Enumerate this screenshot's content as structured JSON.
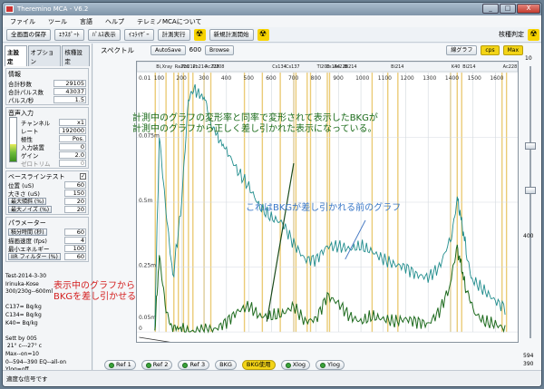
{
  "window": {
    "title": "Theremino MCA - V6.2",
    "buttons": [
      "_",
      "□",
      "X"
    ]
  },
  "menu": [
    "ファイル",
    "ツール",
    "言語",
    "ヘルプ",
    "テレミノMCAについて"
  ],
  "toolbar": {
    "buttons": [
      "全画面の保存",
      "ｴｸｽﾎﾟｰﾄ",
      "ﾊﾟﾙｽ表示",
      "ｲｺﾗｲｻﾞｰ",
      "計測実行",
      "新規計測開始"
    ],
    "right_label": "核種判定"
  },
  "left_panel": {
    "tabs": [
      "主設定",
      "オプション",
      "核種設定"
    ],
    "info": {
      "title": "情報",
      "rows": [
        {
          "label": "合計秒数",
          "value": "29105"
        },
        {
          "label": "合計パルス数",
          "value": "43037"
        },
        {
          "label": "パルス/秒",
          "value": "1.5"
        }
      ]
    },
    "audio": {
      "title": "音声入力",
      "rows": [
        {
          "label": "チャンネル",
          "value": "x1"
        },
        {
          "label": "レート",
          "value": "192000"
        },
        {
          "label": "極性",
          "value": "Pos."
        },
        {
          "label": "入力装置",
          "value": "0"
        },
        {
          "label": "ゲイン",
          "value": "2.0"
        },
        {
          "label": "ゼロトリム",
          "value": "0"
        }
      ]
    },
    "baseline": {
      "title": "ベースラインテスト",
      "rows": [
        {
          "label": "位置 (uS)",
          "value": "60"
        },
        {
          "label": "大きさ (uS)",
          "value": "150"
        },
        {
          "label": "最大傾斜 (%)",
          "value": "20"
        },
        {
          "label": "最大ノイズ (%)",
          "value": "20"
        }
      ]
    },
    "params": {
      "title": "パラメーター",
      "rows": [
        {
          "label": "積分時間 (秒)",
          "value": "60"
        },
        {
          "label": "描画速度 (fps)",
          "value": "4"
        },
        {
          "label": "最小エネルギー",
          "value": "100"
        },
        {
          "label": "IIR フィルター (%)",
          "value": "60"
        }
      ]
    },
    "notes": "Test-2014-3-30\nIrinuka-Kose\n300/230g--600ml\n \nC137= Bq/kg\nC134= Bq/kg\nK40= Bq/kg\n \nSett by 005\n 21° c---27° c\nMax--on=10\n0--594--390 EQ--all-on\nYlog=off"
  },
  "chart_toolbar": {
    "label": "スペクトル",
    "autosave": "AutoSave",
    "interval": "600",
    "browse": "Browse",
    "graph_btn": "線グラフ",
    "unit": "cps",
    "max": "Max"
  },
  "isotopes": [
    "Bi,Xray",
    "Ra226",
    "Pb212",
    "Pb214",
    "Ac228",
    "Tl208",
    "Cs134",
    "Cs137",
    "Tl208",
    "Cs134",
    "Ac228",
    "Bi214",
    "Bi214",
    "K40",
    "Bi214",
    "Ac228"
  ],
  "chart_data": {
    "type": "line",
    "xlabel": "",
    "ylabel": "",
    "x_ticks": [
      100,
      200,
      300,
      400,
      500,
      600,
      700,
      800,
      900,
      1000,
      1100,
      1200,
      1300,
      1400,
      1500,
      1600
    ],
    "y_ticks": [
      "0.01",
      "0.075m",
      "0.5m",
      "0.25m",
      "0.05m",
      "0"
    ],
    "xlim": [
      0,
      1700
    ],
    "ylim": [
      0,
      0.01
    ],
    "series": [
      {
        "name": "",
        "color": "#1f8c8c",
        "values_x": [
          80,
          100,
          130,
          160,
          200,
          230,
          260,
          300,
          330,
          360,
          400,
          450,
          500,
          550,
          600,
          650,
          700,
          750,
          800,
          850,
          900,
          950,
          1000,
          1050,
          1100,
          1150,
          1200,
          1250,
          1300,
          1350,
          1400,
          1430,
          1450,
          1470,
          1500,
          1550,
          1600,
          1650
        ],
        "values_y": [
          0.0003,
          0.0075,
          0.0045,
          0.002,
          0.005,
          0.0088,
          0.0093,
          0.009,
          0.0078,
          0.0075,
          0.007,
          0.0062,
          0.0056,
          0.0048,
          0.0044,
          0.0042,
          0.0034,
          0.0028,
          0.0028,
          0.0033,
          0.0033,
          0.0032,
          0.0033,
          0.0031,
          0.0028,
          0.0026,
          0.0025,
          0.0022,
          0.0021,
          0.0025,
          0.0036,
          0.0052,
          0.0042,
          0.0032,
          0.002,
          0.0016,
          0.0012,
          0.0009
        ]
      },
      {
        "name": "",
        "color": "#1e6b1e",
        "values_x": [
          80,
          100,
          130,
          160,
          200,
          250,
          300,
          350,
          400,
          450,
          500,
          550,
          600,
          650,
          700,
          750,
          800,
          850,
          900,
          950,
          1000,
          1050,
          1100,
          1150,
          1200,
          1250,
          1300,
          1350,
          1400,
          1430,
          1450,
          1470,
          1500,
          1550,
          1600,
          1650
        ],
        "values_y": [
          0.0,
          0.003,
          0.001,
          0.0002,
          0.0001,
          0.0,
          0.0001,
          0.0001,
          0.0004,
          0.0008,
          0.001,
          0.0006,
          0.0006,
          0.0007,
          0.001,
          0.0004,
          0.0005,
          0.0014,
          0.0011,
          0.0006,
          0.0004,
          0.0006,
          0.0005,
          0.0004,
          0.0005,
          0.0004,
          0.0003,
          0.0008,
          0.0018,
          0.0032,
          0.0025,
          0.0015,
          0.0008,
          0.0004,
          0.0003,
          0.0001
        ]
      }
    ]
  },
  "annotations": {
    "a1": "計測中のグラフの変形率と同率で変形されて表示したBKGが\n計測中のグラフから正しく差し引かれた表示になっている。",
    "a2": "これはBKGが差し引かれる前のグラフ",
    "a3": "表示中のグラフから\nBKGを差し引かせる"
  },
  "bottom_buttons": [
    "Ref 1",
    "Ref 2",
    "Ref 3",
    "BKG",
    "BKG使用",
    "Xlog",
    "Ylog"
  ],
  "right_slider": {
    "top": "10",
    "mid": "400",
    "bottom1": "594",
    "bottom2": "390"
  },
  "status": "適度な信号です"
}
